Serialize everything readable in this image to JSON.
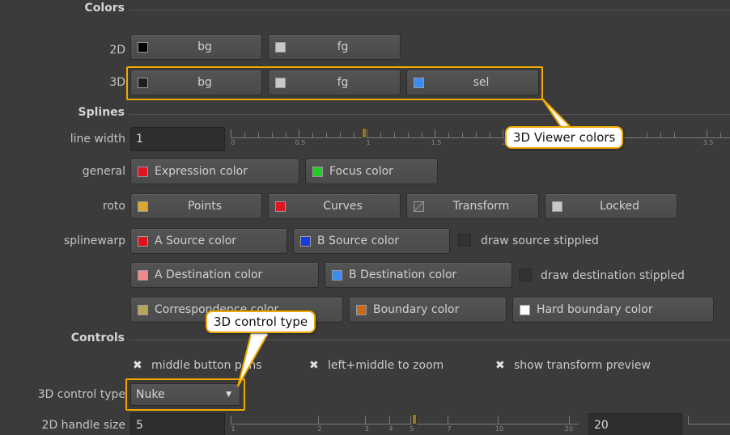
{
  "sections": {
    "colors": "Colors",
    "splines": "Splines",
    "controls": "Controls"
  },
  "colors": {
    "row2d": {
      "label": "2D",
      "bg": "bg",
      "fg": "fg",
      "bg_swatch": "#000000",
      "fg_swatch": "#c8c8c8"
    },
    "row3d": {
      "label": "3D",
      "bg": "bg",
      "fg": "fg",
      "sel": "sel",
      "bg_swatch": "#1e1e1e",
      "fg_swatch": "#c8c8c8",
      "sel_swatch": "#3a8cf0"
    }
  },
  "splines": {
    "line_width": {
      "label": "line width",
      "value": "1",
      "ticks": [
        "0",
        "0.5",
        "1",
        "1.5",
        "2",
        "3.5"
      ]
    },
    "general": {
      "label": "general",
      "expression": "Expression color",
      "focus": "Focus color",
      "expression_swatch": "#e0141e",
      "focus_swatch": "#22cc22"
    },
    "roto": {
      "label": "roto",
      "points": "Points",
      "curves": "Curves",
      "transform": "Transform",
      "locked": "Locked",
      "points_swatch": "#d9a830",
      "curves_swatch": "#e0141e",
      "transform_swatch": "#8a8a8a",
      "locked_swatch": "#c8c8c8"
    },
    "splinewarp": {
      "label": "splinewarp",
      "a_source": "A Source color",
      "b_source": "B Source color",
      "draw_source": "draw source stippled",
      "a_dest": "A Destination color",
      "b_dest": "B Destination color",
      "draw_dest": "draw destination stippled",
      "corresp": "Correspondence color",
      "boundary": "Boundary color",
      "hard_boundary": "Hard boundary color",
      "a_source_swatch": "#e0141e",
      "b_source_swatch": "#1a3cdc",
      "a_dest_swatch": "#f08a8a",
      "b_dest_swatch": "#3a8cf0",
      "corresp_swatch": "#b5a55a",
      "boundary_swatch": "#c86a1a",
      "hard_boundary_swatch": "#ffffff"
    }
  },
  "controls": {
    "middle_button": "middle button pans",
    "left_middle": "left+middle to zoom",
    "show_transform": "show transform preview",
    "control_type_label": "3D control type",
    "control_type_value": "Nuke",
    "handle_label": "2D handle size",
    "handle_value": "5",
    "handle_value2": "20",
    "handle_ticks": [
      "1",
      "2",
      "3",
      "4",
      "5",
      "7",
      "10",
      "20"
    ]
  },
  "callouts": {
    "viewer": "3D Viewer colors",
    "control": "3D control type"
  },
  "accent": "#f0a800"
}
